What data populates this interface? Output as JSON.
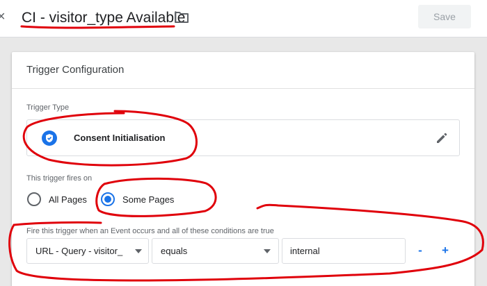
{
  "header": {
    "close_glyph": "×",
    "title": "CI - visitor_type Available",
    "folder_icon": "folder-icon",
    "save_label": "Save"
  },
  "card": {
    "title": "Trigger Configuration",
    "trigger_type": {
      "label": "Trigger Type",
      "name": "Consent Initialisation",
      "icon": "shield-icon",
      "edit_icon": "pencil-icon"
    },
    "fires_on": {
      "label": "This trigger fires on",
      "options": [
        {
          "label": "All Pages",
          "selected": false
        },
        {
          "label": "Some Pages",
          "selected": true
        }
      ]
    },
    "conditions": {
      "label": "Fire this trigger when an Event occurs and all of these conditions are true",
      "variable": "URL - Query - visitor_",
      "operator": "equals",
      "value": "internal",
      "remove_label": "-",
      "add_label": "+"
    }
  },
  "colors": {
    "accent": "#1a73e8",
    "annotation": "#e0000a"
  }
}
